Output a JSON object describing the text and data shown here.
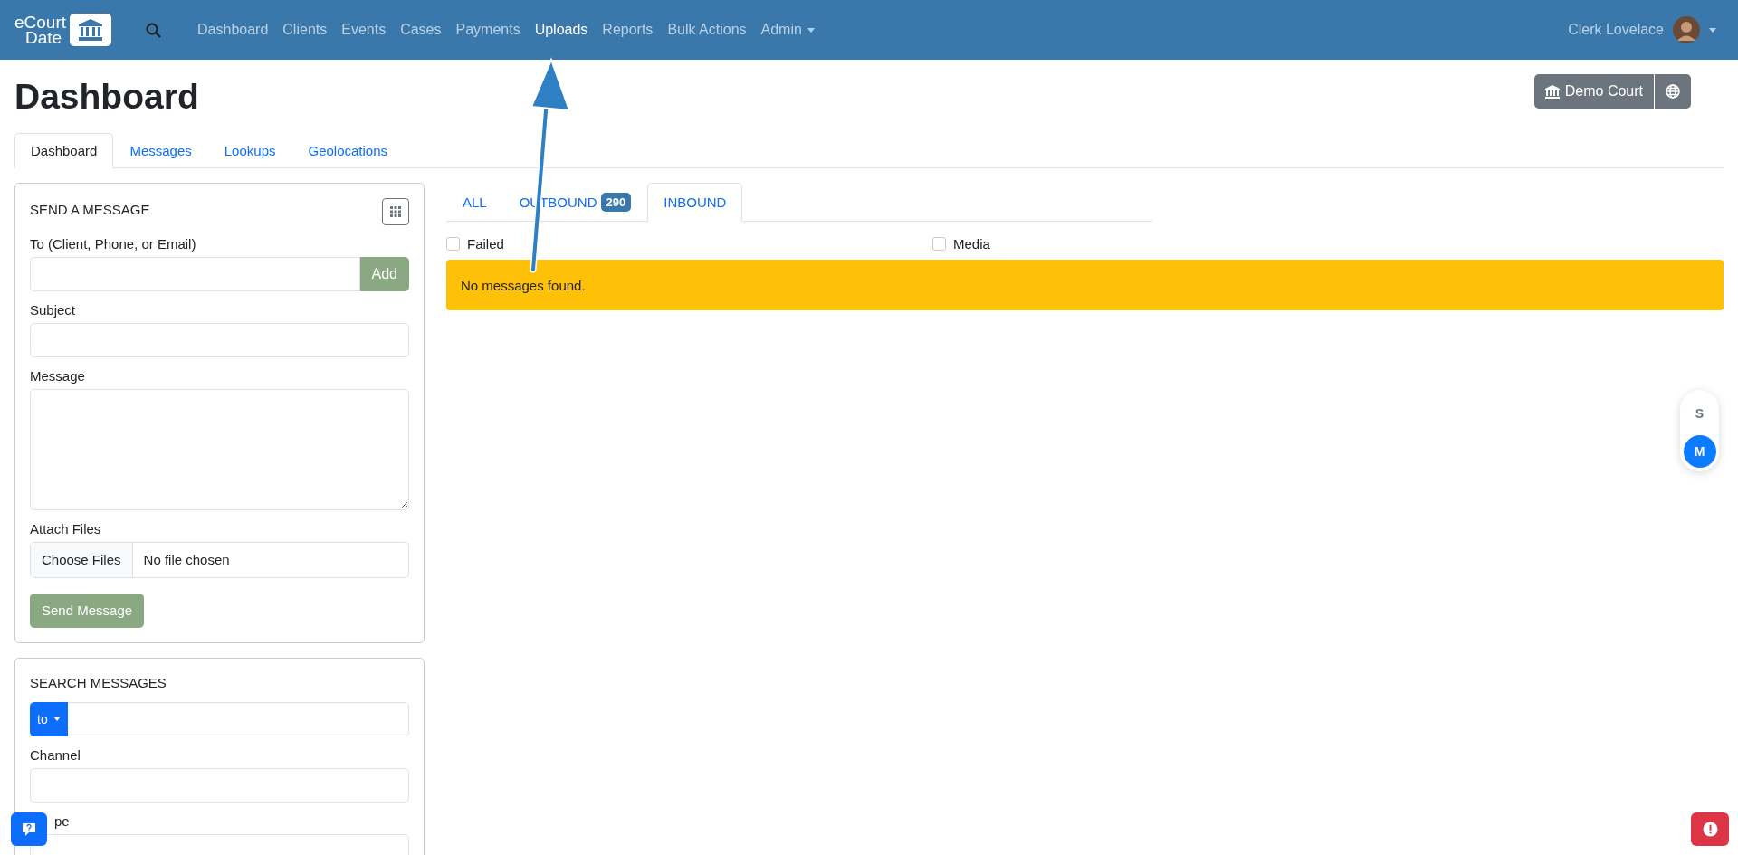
{
  "navbar": {
    "brand": [
      "eCourt",
      "Date"
    ],
    "menu": [
      {
        "label": "Dashboard",
        "selected": false
      },
      {
        "label": "Clients",
        "selected": false
      },
      {
        "label": "Events",
        "selected": false
      },
      {
        "label": "Cases",
        "selected": false
      },
      {
        "label": "Payments",
        "selected": false
      },
      {
        "label": "Uploads",
        "selected": true
      },
      {
        "label": "Reports",
        "selected": false
      },
      {
        "label": "Bulk Actions",
        "selected": false
      }
    ],
    "admin": "Admin",
    "user": "Clerk Lovelace"
  },
  "page_title": "Dashboard",
  "court_button": "Demo Court",
  "tabs": [
    {
      "label": "Dashboard",
      "selected": true
    },
    {
      "label": "Messages",
      "selected": false
    },
    {
      "label": "Lookups",
      "selected": false
    },
    {
      "label": "Geolocations",
      "selected": false
    }
  ],
  "send_message": {
    "title": "SEND A MESSAGE",
    "to_label": "To (Client, Phone, or Email)",
    "add_button": "Add",
    "subject_label": "Subject",
    "message_label": "Message",
    "attach_label": "Attach Files",
    "choose_files": "Choose Files",
    "no_file": "No file chosen",
    "send_button": "Send Message"
  },
  "search_messages": {
    "title": "SEARCH MESSAGES",
    "direction": "to",
    "channel_label": "Channel",
    "type_label": "pe"
  },
  "message_tabs": [
    {
      "label": "ALL",
      "selected": false
    },
    {
      "label": "OUTBOUND",
      "badge": "290",
      "selected": false
    },
    {
      "label": "INBOUND",
      "selected": true
    }
  ],
  "filters": [
    {
      "label": "Failed",
      "checked": false
    },
    {
      "label": "Media",
      "checked": false
    }
  ],
  "alert": "No messages found.",
  "size_toggle": [
    {
      "label": "S",
      "selected": false
    },
    {
      "label": "M",
      "selected": true
    }
  ]
}
